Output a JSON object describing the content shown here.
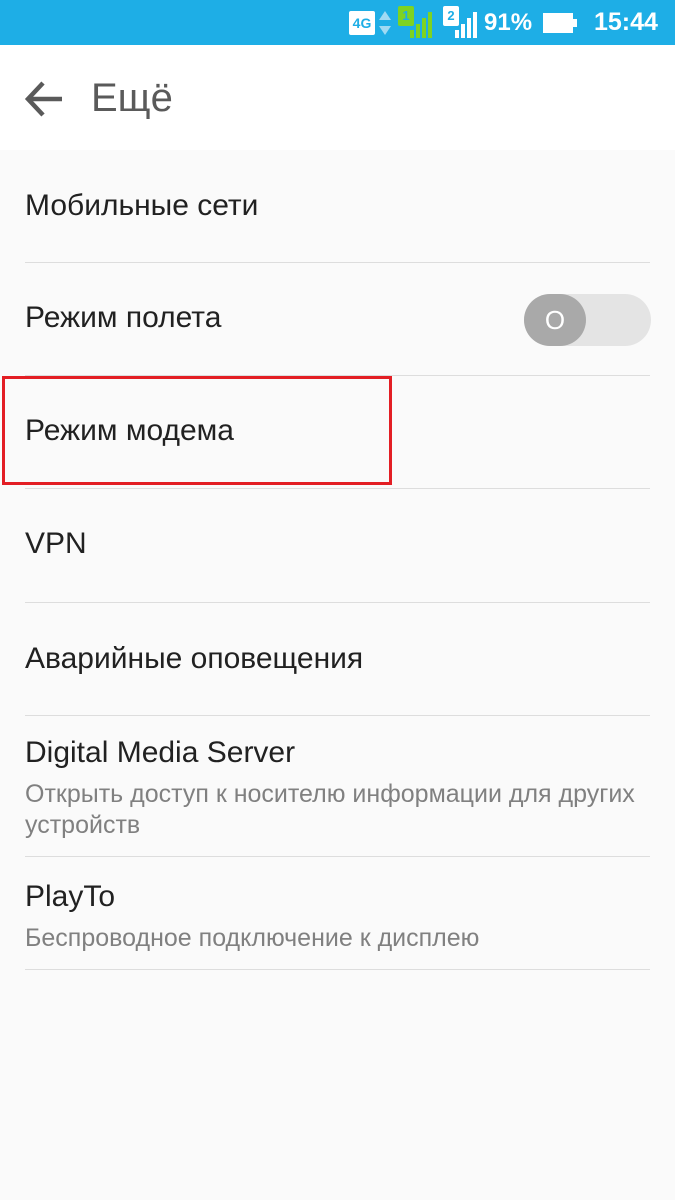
{
  "status_bar": {
    "network_type": "4G",
    "sim1_label": "1",
    "sim2_label": "2",
    "battery_percent": "91%",
    "time": "15:44",
    "background_color": "#1eaee6",
    "icons": [
      "data-arrows-icon",
      "signal-icon",
      "battery-icon"
    ]
  },
  "app_bar": {
    "title": "Ещё",
    "back_icon": "arrow-left-icon"
  },
  "settings": {
    "items": [
      {
        "title": "Мобильные сети"
      },
      {
        "title": "Режим полета",
        "toggle_label": "O",
        "toggle_state": "off"
      },
      {
        "title": "Режим модема",
        "highlighted": true
      },
      {
        "title": "VPN"
      },
      {
        "title": "Аварийные оповещения"
      },
      {
        "title": "Digital Media Server",
        "subtitle": "Открыть доступ к носителю информации для других устройств"
      },
      {
        "title": "PlayTo",
        "subtitle": "Беспроводное подключение к дисплею"
      }
    ]
  },
  "colors": {
    "highlight": "#e31e24",
    "toggle_track": "#e4e4e4",
    "toggle_thumb": "#a9a9a9"
  }
}
